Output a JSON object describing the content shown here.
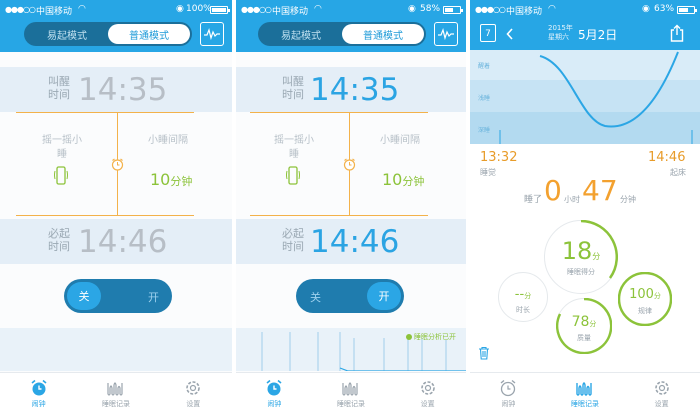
{
  "colors": {
    "header_blue": "#27a6e5",
    "accent_orange": "#f3b24b",
    "accent_green": "#8cc33a",
    "time_orange": "#e89c2a"
  },
  "screen1": {
    "status": {
      "carrier": "中国移动",
      "battery": "100%",
      "battery_level": 1.0
    },
    "mode_tabs": [
      "易起模式",
      "普通模式"
    ],
    "active_mode": "普通模式",
    "wake": {
      "label": "叫醒时间",
      "time": "14:35"
    },
    "shake": {
      "label": "摇一摇小睡"
    },
    "nap": {
      "label": "小睡间隔",
      "value": "10",
      "unit": "分钟"
    },
    "must_wake": {
      "label": "必起时间",
      "time": "14:46"
    },
    "toggle": {
      "off_label": "关",
      "on_label": "开",
      "state": "off"
    },
    "tabs": [
      {
        "icon": "alarm-clock-icon",
        "label": "闹钟",
        "active": true
      },
      {
        "icon": "sleep-record-icon",
        "label": "睡眠记录",
        "active": false
      },
      {
        "icon": "gear-icon",
        "label": "设置",
        "active": false
      }
    ]
  },
  "screen2": {
    "status": {
      "carrier": "中国移动",
      "battery": "58%",
      "battery_level": 0.58
    },
    "mode_tabs": [
      "易起模式",
      "普通模式"
    ],
    "active_mode": "普通模式",
    "wake": {
      "label": "叫醒时间",
      "time": "14:35"
    },
    "shake": {
      "label": "摇一摇小睡"
    },
    "nap": {
      "label": "小睡间隔",
      "value": "10",
      "unit": "分钟"
    },
    "must_wake": {
      "label": "必起时间",
      "time": "14:46"
    },
    "toggle": {
      "off_label": "关",
      "on_label": "开",
      "state": "on"
    },
    "legend": "睡眠分析已开",
    "tabs": [
      {
        "icon": "alarm-clock-icon",
        "label": "闹钟",
        "active": true
      },
      {
        "icon": "sleep-record-icon",
        "label": "睡眠记录",
        "active": false
      },
      {
        "icon": "gear-icon",
        "label": "设置",
        "active": false
      }
    ]
  },
  "screen3": {
    "status": {
      "carrier": "中国移动",
      "battery": "63%",
      "battery_level": 0.63
    },
    "date": {
      "year": "2015年",
      "weekday": "星期六",
      "day": "5月2日"
    },
    "calendar_day": "7",
    "stages": [
      "醒着",
      "浅睡",
      "深睡"
    ],
    "sleep_time": {
      "time": "13:32",
      "label": "睡觉"
    },
    "wake_time": {
      "time": "14:46",
      "label": "起床"
    },
    "duration": {
      "prefix": "睡了",
      "hours": "0",
      "hours_unit": "小时",
      "minutes": "47",
      "minutes_unit": "分钟"
    },
    "score": {
      "value": "18",
      "unit": "分",
      "label": "睡眠得分"
    },
    "length": {
      "value": "--",
      "unit": "分",
      "label": "时长"
    },
    "regularity": {
      "value": "100",
      "unit": "分",
      "label": "规律"
    },
    "depth": {
      "value": "78",
      "unit": "分",
      "label": "质量"
    },
    "tabs": [
      {
        "icon": "alarm-clock-icon",
        "label": "闹钟",
        "active": false
      },
      {
        "icon": "sleep-record-icon",
        "label": "睡眠记录",
        "active": true
      },
      {
        "icon": "gear-icon",
        "label": "设置",
        "active": false
      }
    ]
  }
}
